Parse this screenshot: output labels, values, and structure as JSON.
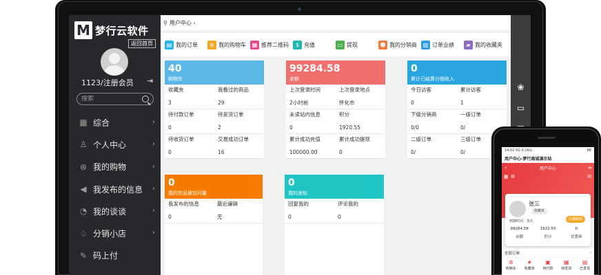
{
  "brand": {
    "logo_mark": "M",
    "name": "梦行云软件",
    "back_home": "返回首页"
  },
  "user": {
    "name": "1123/注册会员"
  },
  "search": {
    "placeholder": "搜索"
  },
  "nav": [
    {
      "label": "综合",
      "icon": "grid-icon"
    },
    {
      "label": "个人中心",
      "icon": "person-icon"
    },
    {
      "label": "我的购物",
      "icon": "cart-icon"
    },
    {
      "label": "我发布的信息",
      "icon": "megaphone-icon"
    },
    {
      "label": "我的谈谈",
      "icon": "chat-icon"
    },
    {
      "label": "分销小店",
      "icon": "shop-icon"
    },
    {
      "label": "码上付",
      "icon": "pen-icon"
    }
  ],
  "breadcrumb": {
    "text": "用户中心 ›"
  },
  "shortcuts": [
    {
      "label": "我的订单",
      "color": "#26b5e4",
      "icon": "order-icon"
    },
    {
      "label": "我的购物车",
      "color": "#f5a623",
      "icon": "cart-icon"
    },
    {
      "label": "推荐二维码",
      "color": "#e74c8a",
      "icon": "qrcode-icon"
    },
    {
      "label": "充值",
      "color": "#1fb8b0",
      "icon": "money-icon"
    },
    {
      "label": "提现",
      "color": "#4caf50",
      "icon": "withdraw-icon"
    },
    {
      "label": "我的分销商",
      "color": "#f07b3f",
      "icon": "people-icon"
    },
    {
      "label": "订单业绩",
      "color": "#2f9de0",
      "icon": "chart-icon"
    },
    {
      "label": "我的收藏夹",
      "color": "#8e6bbf",
      "icon": "folder-icon"
    }
  ],
  "cards": {
    "cart": {
      "number": "40",
      "subtitle": "购物车",
      "color": "#5bb8e6",
      "cells": [
        {
          "label": "收藏夹",
          "value": "3"
        },
        {
          "label": "我看过的商品",
          "value": "29"
        },
        {
          "label": "待付款订单",
          "value": "0"
        },
        {
          "label": "待发货订单",
          "value": "2"
        },
        {
          "label": "待收货订单",
          "value": "0"
        },
        {
          "label": "交易成功订单",
          "value": "16"
        }
      ]
    },
    "balance": {
      "number": "99284.58",
      "subtitle": "余额",
      "color": "#f07070",
      "cells": [
        {
          "label": "上次登录时间",
          "value": "2小时前"
        },
        {
          "label": "上次登录地点",
          "value": "怀化市"
        },
        {
          "label": "未读站内信息",
          "value": "0"
        },
        {
          "label": "积分",
          "value": "1920.55"
        },
        {
          "label": "累计成功充值",
          "value": "100000.00"
        },
        {
          "label": "累计成功提现",
          "value": "0"
        }
      ]
    },
    "income": {
      "number": "0",
      "subtitle": "累计已结算分销收入",
      "color": "#2aa5e0",
      "cells": [
        {
          "label": "今日访客",
          "value": "0"
        },
        {
          "label": "累计访客",
          "value": "1"
        },
        {
          "label": "下级分销商",
          "value": "0/0"
        },
        {
          "label": "一级订单",
          "value": "0/"
        },
        {
          "label": "二级订单",
          "value": "0/"
        },
        {
          "label": "三级订单",
          "value": "0/"
        }
      ]
    },
    "posts": {
      "number": "0",
      "subtitle": "我的信息被访问量",
      "color": "#f57c00",
      "cells": [
        {
          "label": "我发布的信息",
          "value": "0"
        },
        {
          "label": "最近编辑",
          "value": "无"
        }
      ]
    },
    "topics": {
      "number": "0",
      "subtitle": "我的发帖",
      "color": "#1fc4c4",
      "cells": [
        {
          "label": "回复我的",
          "value": "0"
        },
        {
          "label": "评论我的",
          "value": "0"
        }
      ]
    }
  },
  "right_strip": {
    "icons": [
      "wechat-icon",
      "message-icon",
      "more-icon"
    ]
  },
  "phone": {
    "status_left": "14:52 5G 0.1K/s",
    "status_right": "88",
    "title": "用户中心-梦行商城演示站",
    "header": "用户中心",
    "name": "张三",
    "badge": "收藏夹",
    "time": "到期时间：永久",
    "button": "分销级别",
    "stats": [
      {
        "value": "99284.58",
        "label": "余额"
      },
      {
        "value": "1922.55",
        "label": "积分"
      },
      {
        "value": "0",
        "label": "优惠券"
      }
    ],
    "orders_label": "全部订单",
    "orders_link": "›",
    "tabs": [
      {
        "label": "购物车",
        "icon": "cart-icon"
      },
      {
        "label": "收藏夹",
        "icon": "star-icon"
      },
      {
        "label": "待付款",
        "icon": "wallet-icon"
      },
      {
        "label": "待发货",
        "icon": "box-icon"
      },
      {
        "label": "已发货",
        "icon": "truck-icon"
      }
    ]
  }
}
